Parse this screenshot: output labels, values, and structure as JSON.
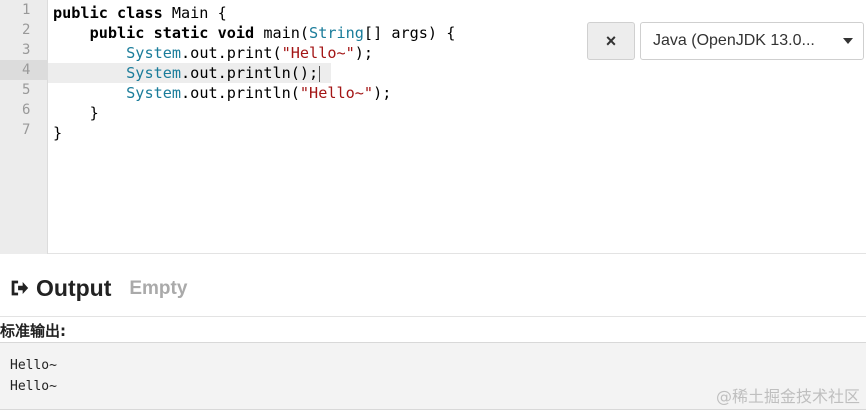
{
  "editor": {
    "line_numbers": [
      "1",
      "2",
      "3",
      "4",
      "5",
      "6",
      "7"
    ],
    "lines": [
      [
        {
          "t": "public class",
          "c": "kw"
        },
        {
          "t": " Main {",
          "c": ""
        }
      ],
      [
        {
          "t": "    ",
          "c": ""
        },
        {
          "t": "public static void",
          "c": "kw"
        },
        {
          "t": " main(",
          "c": ""
        },
        {
          "t": "String",
          "c": "ty"
        },
        {
          "t": "[] args) {",
          "c": ""
        }
      ],
      [
        {
          "t": "        ",
          "c": ""
        },
        {
          "t": "System",
          "c": "ty"
        },
        {
          "t": ".out.print(",
          "c": ""
        },
        {
          "t": "\"Hello~\"",
          "c": "str"
        },
        {
          "t": ");",
          "c": ""
        }
      ],
      [
        {
          "t": "        ",
          "c": ""
        },
        {
          "t": "System",
          "c": "ty"
        },
        {
          "t": ".out.println();",
          "c": ""
        }
      ],
      [
        {
          "t": "        ",
          "c": ""
        },
        {
          "t": "System",
          "c": "ty"
        },
        {
          "t": ".out.println(",
          "c": ""
        },
        {
          "t": "\"Hello~\"",
          "c": "str"
        },
        {
          "t": ");",
          "c": ""
        }
      ],
      [
        {
          "t": "    }",
          "c": ""
        }
      ],
      [
        {
          "t": "}",
          "c": ""
        }
      ]
    ],
    "active_line": 4
  },
  "toolbar": {
    "clear_icon": "×",
    "language": "Java (OpenJDK 13.0..."
  },
  "output": {
    "title": "Output",
    "status": "Empty",
    "stdout_label": "标准输出:",
    "stdout_lines": [
      "Hello~",
      "Hello~"
    ]
  },
  "watermark": "@稀土掘金技术社区"
}
